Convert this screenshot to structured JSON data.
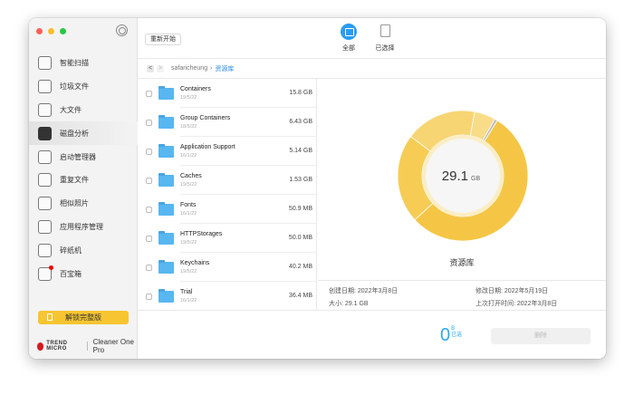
{
  "sidebar": {
    "items": [
      {
        "label": "智能扫描",
        "icon": "smart-scan-icon"
      },
      {
        "label": "垃圾文件",
        "icon": "junk-files-icon"
      },
      {
        "label": "大文件",
        "icon": "big-files-icon"
      },
      {
        "label": "磁盘分析",
        "icon": "disk-analysis-icon",
        "active": true
      },
      {
        "label": "启动管理器",
        "icon": "startup-manager-icon"
      },
      {
        "label": "重复文件",
        "icon": "duplicate-files-icon"
      },
      {
        "label": "相似照片",
        "icon": "similar-photos-icon"
      },
      {
        "label": "应用程序管理",
        "icon": "app-manager-icon"
      },
      {
        "label": "碎纸机",
        "icon": "shredder-icon"
      },
      {
        "label": "百宝箱",
        "icon": "toolbox-icon",
        "badge": true
      }
    ],
    "unlock_label": "解锁完整版",
    "brand": "TREND MICRO",
    "product": "Cleaner One Pro"
  },
  "toolbar": {
    "restart_label": "重新开始",
    "tab_all": "全部",
    "tab_selected": "已选择"
  },
  "breadcrumb": {
    "back": "<",
    "forward": ">",
    "parent": "safaricheung",
    "current": "资源库"
  },
  "files": [
    {
      "name": "Containers",
      "date": "19/5/22",
      "size": "15.8 GB"
    },
    {
      "name": "Group Containers",
      "date": "18/5/22",
      "size": "6.43 GB"
    },
    {
      "name": "Application Support",
      "date": "16/1/22",
      "size": "5.14 GB"
    },
    {
      "name": "Caches",
      "date": "19/5/22",
      "size": "1.53 GB"
    },
    {
      "name": "Fonts",
      "date": "16/1/22",
      "size": "50.9 MB"
    },
    {
      "name": "HTTPStorages",
      "date": "19/5/22",
      "size": "50.0 MB"
    },
    {
      "name": "Keychains",
      "date": "19/5/22",
      "size": "40.2 MB"
    },
    {
      "name": "Trial",
      "date": "16/1/22",
      "size": "36.4 MB"
    }
  ],
  "detail": {
    "total_value": "29.1",
    "total_unit": "GB",
    "name": "资源库",
    "created": "创建日期:   2022年3月8日",
    "size": "大小: 29.1 GB",
    "modified": "修改日期: 2022年5月19日",
    "last_opened": "上次打开时间: 2022年3月8日"
  },
  "chart_data": {
    "type": "pie",
    "donut": true,
    "segments": [
      {
        "label": "Containers",
        "value": 15.8,
        "color": "#f5c645"
      },
      {
        "label": "Group Containers",
        "value": 6.43,
        "color": "#f6cc55"
      },
      {
        "label": "Application Support",
        "value": 5.14,
        "color": "#f7d573"
      },
      {
        "label": "Caches",
        "value": 1.53,
        "color": "#f8dc88"
      },
      {
        "label": "other",
        "value": 0.2,
        "color": "#bdbdbd"
      }
    ]
  },
  "footer": {
    "selected_count": "0",
    "selected_unit": "B",
    "selected_label": "已选",
    "delete_label": "删除"
  },
  "colors": {
    "accent": "#2a9cf2",
    "unlock": "#f7c531"
  }
}
